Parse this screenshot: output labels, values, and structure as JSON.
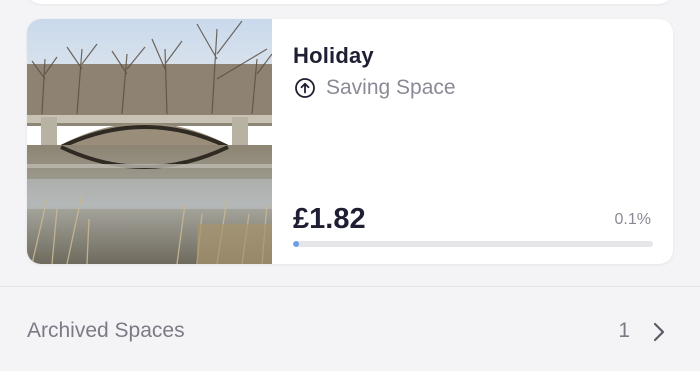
{
  "space": {
    "title": "Holiday",
    "type_icon": "upload-circle-icon",
    "type_label": "Saving Space",
    "balance": "£1.82",
    "progress_text": "0.1%",
    "progress_fraction": 0.001,
    "photo_description_icon": "bridge-photo"
  },
  "archived": {
    "label": "Archived Spaces",
    "count": "1",
    "chevron_icon": "chevron-right-icon"
  },
  "colors": {
    "progress": "#6f9de8",
    "title_text": "#1f1f33",
    "muted_text": "#8a8a96",
    "background": "#f4f4f6"
  }
}
